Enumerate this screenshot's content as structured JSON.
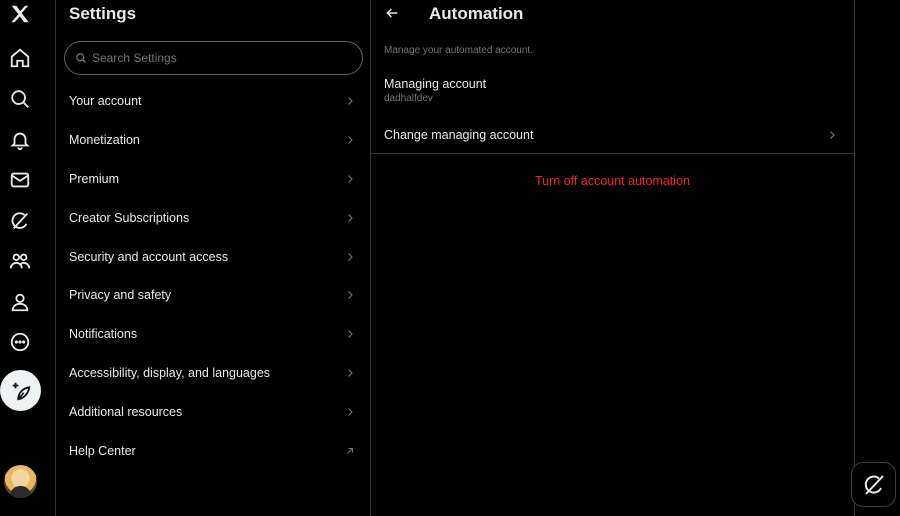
{
  "rail": {
    "items": [
      {
        "icon": "x-logo-icon"
      },
      {
        "icon": "home-icon"
      },
      {
        "icon": "search-icon"
      },
      {
        "icon": "bell-icon"
      },
      {
        "icon": "mail-icon"
      },
      {
        "icon": "grok-icon"
      },
      {
        "icon": "communities-icon"
      },
      {
        "icon": "profile-icon"
      },
      {
        "icon": "more-icon"
      }
    ],
    "post_icon": "compose-post-icon",
    "avatar": "user-avatar"
  },
  "settings": {
    "title": "Settings",
    "search_placeholder": "Search Settings",
    "items": [
      {
        "label": "Your account",
        "icon": "chevron-right-icon"
      },
      {
        "label": "Monetization",
        "icon": "chevron-right-icon"
      },
      {
        "label": "Premium",
        "icon": "chevron-right-icon"
      },
      {
        "label": "Creator Subscriptions",
        "icon": "chevron-right-icon"
      },
      {
        "label": "Security and account access",
        "icon": "chevron-right-icon"
      },
      {
        "label": "Privacy and safety",
        "icon": "chevron-right-icon"
      },
      {
        "label": "Notifications",
        "icon": "chevron-right-icon"
      },
      {
        "label": "Accessibility, display, and languages",
        "icon": "chevron-right-icon"
      },
      {
        "label": "Additional resources",
        "icon": "chevron-right-icon"
      },
      {
        "label": "Help Center",
        "icon": "external-link-icon"
      }
    ]
  },
  "automation": {
    "title": "Automation",
    "description": "Manage your automated account.",
    "managing_label": "Managing account",
    "managing_value": "dadhalfdev",
    "change_label": "Change managing account",
    "turn_off_label": "Turn off account automation"
  },
  "colors": {
    "background": "#000000",
    "text": "#e7e9ea",
    "muted": "#71767b",
    "border": "#2f3336",
    "danger": "#f4212e"
  }
}
